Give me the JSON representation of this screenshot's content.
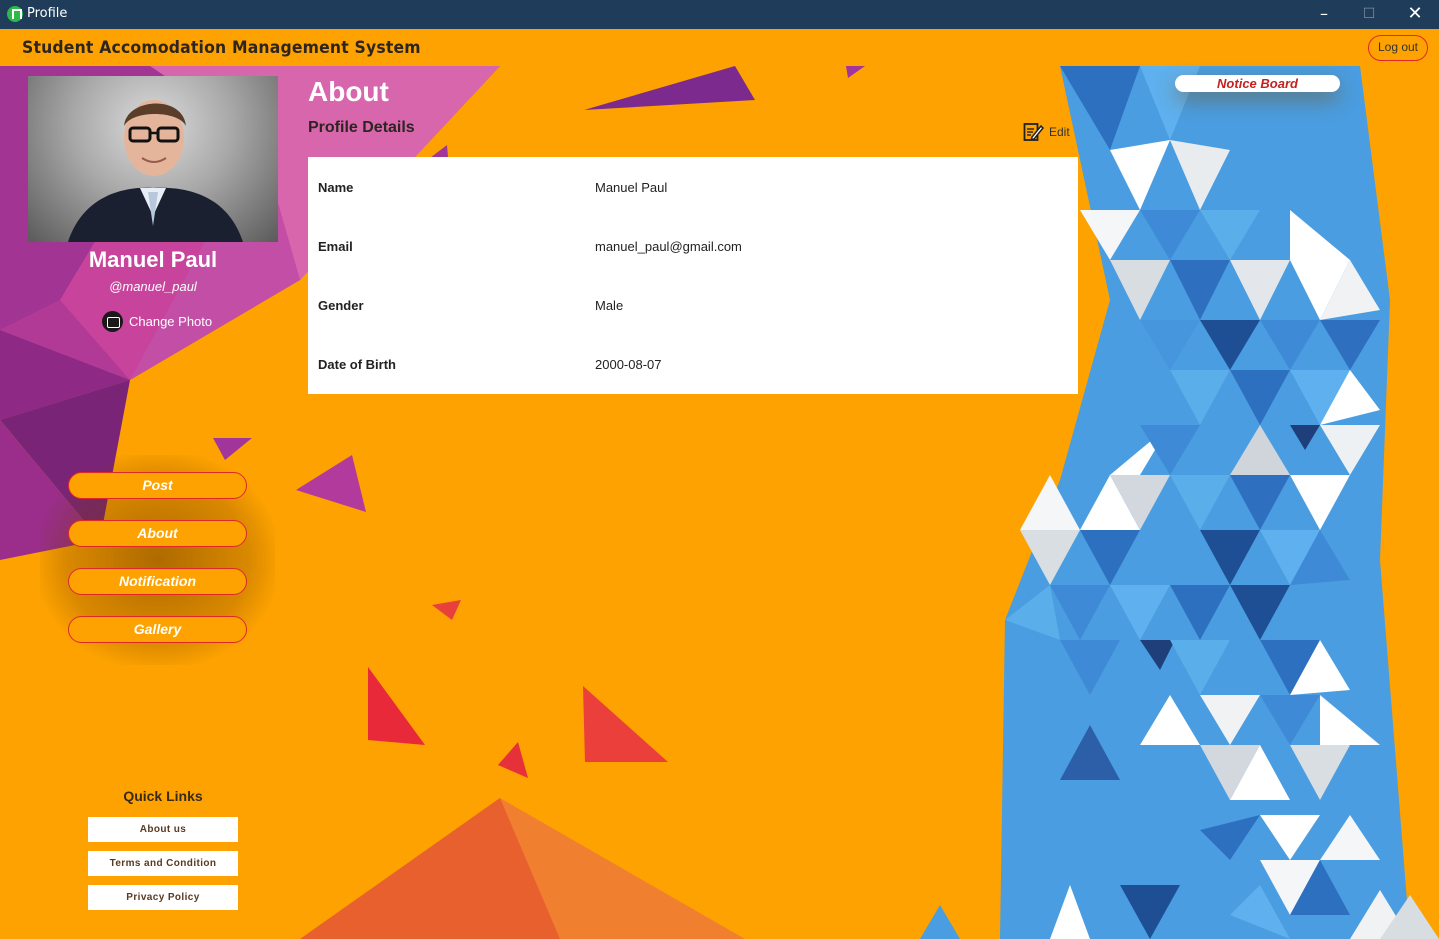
{
  "window": {
    "title": "Profile"
  },
  "header": {
    "app_title": "Student Accomodation Management System",
    "logout_label": "Log out"
  },
  "profile": {
    "name": "Manuel Paul",
    "handle": "@manuel_paul",
    "change_photo_label": "Change Photo"
  },
  "nav": {
    "items": [
      {
        "label": "Post"
      },
      {
        "label": "About"
      },
      {
        "label": "Notification"
      },
      {
        "label": "Gallery"
      }
    ]
  },
  "quick_links": {
    "title": "Quick Links",
    "items": [
      {
        "label": "About us"
      },
      {
        "label": "Terms and Condition"
      },
      {
        "label": "Privacy Policy"
      }
    ]
  },
  "main": {
    "title": "About",
    "subtitle": "Profile Details",
    "edit_label": "Edit",
    "details": [
      {
        "key": "Name",
        "value": "Manuel Paul"
      },
      {
        "key": "Email",
        "value": "manuel_paul@gmail.com"
      },
      {
        "key": "Gender",
        "value": "Male"
      },
      {
        "key": "Date of Birth",
        "value": "2000-08-07"
      }
    ]
  },
  "notice_board": {
    "label": "Notice Board"
  },
  "colors": {
    "background": "#fda200",
    "titlebar": "#1f3d5a",
    "accent_border": "#e0282a",
    "notice_text": "#c62020"
  }
}
